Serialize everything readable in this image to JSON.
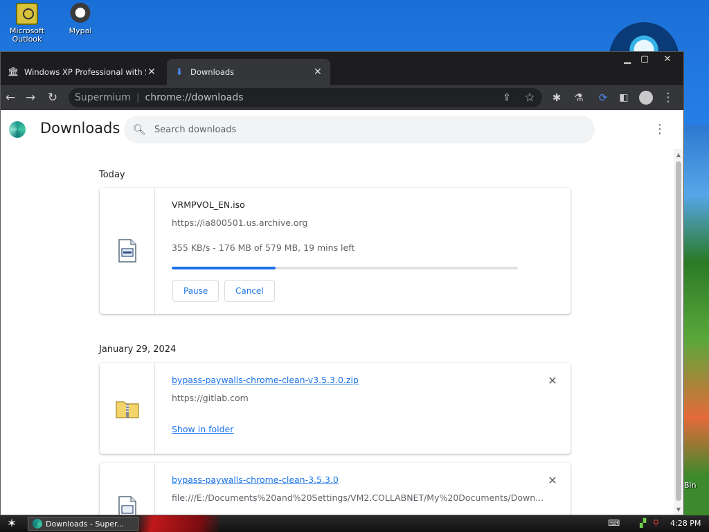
{
  "desktop": {
    "icons": [
      {
        "label": "Microsoft Outlook"
      },
      {
        "label": "Mypal"
      }
    ],
    "recycle_label": "Bin"
  },
  "browser": {
    "tabs": [
      {
        "title": "Windows XP Professional with Servi",
        "icon": "library-icon",
        "active": false
      },
      {
        "title": "Downloads",
        "icon": "download-icon",
        "active": true
      }
    ],
    "toolbar": {
      "site_label": "Supermium",
      "url": "chrome://downloads"
    }
  },
  "downloads_page": {
    "title": "Downloads",
    "search_placeholder": "Search downloads",
    "groups": [
      {
        "date": "Today",
        "items": [
          {
            "file_name": "VRMPVOL_EN.iso",
            "source": "https://ia800501.us.archive.org",
            "status": "355 KB/s - 176 MB of 579 MB, 19 mins left",
            "progress": 0.3,
            "pause_label": "Pause",
            "cancel_label": "Cancel"
          }
        ]
      },
      {
        "date": "January 29, 2024",
        "items": [
          {
            "file_name": "bypass-paywalls-chrome-clean-v3.5.3.0.zip",
            "source": "https://gitlab.com",
            "show_in_folder_label": "Show in folder"
          },
          {
            "file_name": "bypass-paywalls-chrome-clean-3.5.3.0",
            "source": "file:///E:/Documents%20and%20Settings/VM2.COLLABNET/My%20Documents/Down..."
          }
        ]
      }
    ]
  },
  "taskbar": {
    "task_label": "Downloads - Super...",
    "clock": "4:28 PM"
  }
}
